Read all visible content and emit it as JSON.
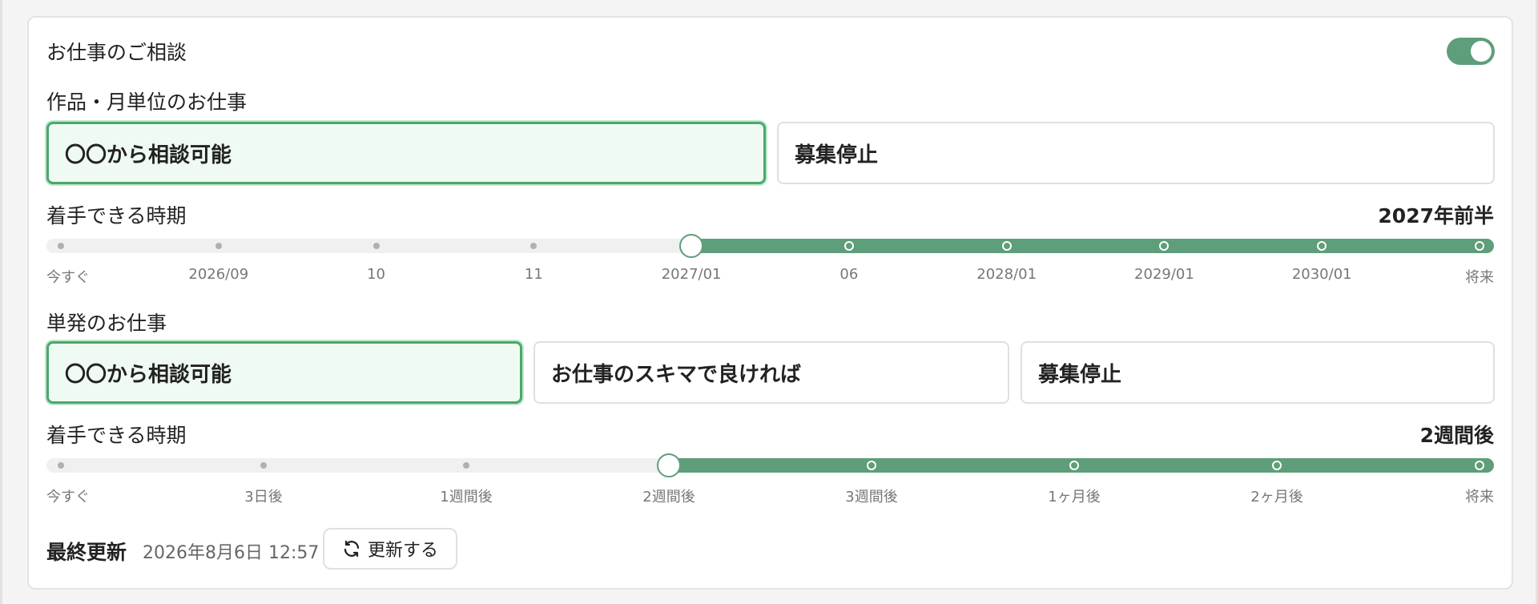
{
  "header": {
    "title": "お仕事のご相談",
    "toggle_on": true
  },
  "project_work": {
    "title": "作品・月単位のお仕事",
    "options": [
      {
        "label": "〇〇から相談可能",
        "selected": true
      },
      {
        "label": "募集停止",
        "selected": false
      }
    ],
    "period_label": "着手できる時期",
    "period_value": "2027年前半",
    "slider": {
      "ticks": [
        "今すぐ",
        "2026/09",
        "10",
        "11",
        "2027/01",
        "06",
        "2028/01",
        "2029/01",
        "2030/01",
        "将来"
      ],
      "selected_index": 4
    }
  },
  "single_work": {
    "title": "単発のお仕事",
    "options": [
      {
        "label": "〇〇から相談可能",
        "selected": true
      },
      {
        "label": "お仕事のスキマで良ければ",
        "selected": false
      },
      {
        "label": "募集停止",
        "selected": false
      }
    ],
    "period_label": "着手できる時期",
    "period_value": "2週間後",
    "slider": {
      "ticks": [
        "今すぐ",
        "3日後",
        "1週間後",
        "2週間後",
        "3週間後",
        "1ヶ月後",
        "2ヶ月後",
        "将来"
      ],
      "selected_index": 3
    }
  },
  "footer": {
    "label": "最終更新",
    "date": "2026年8月6日 12:57",
    "refresh_label": "更新する",
    "refresh_icon": "refresh-icon"
  },
  "colors": {
    "accent": "#5e9e7a",
    "selected_border": "#4aa86d",
    "selected_bg": "#effaf2"
  }
}
